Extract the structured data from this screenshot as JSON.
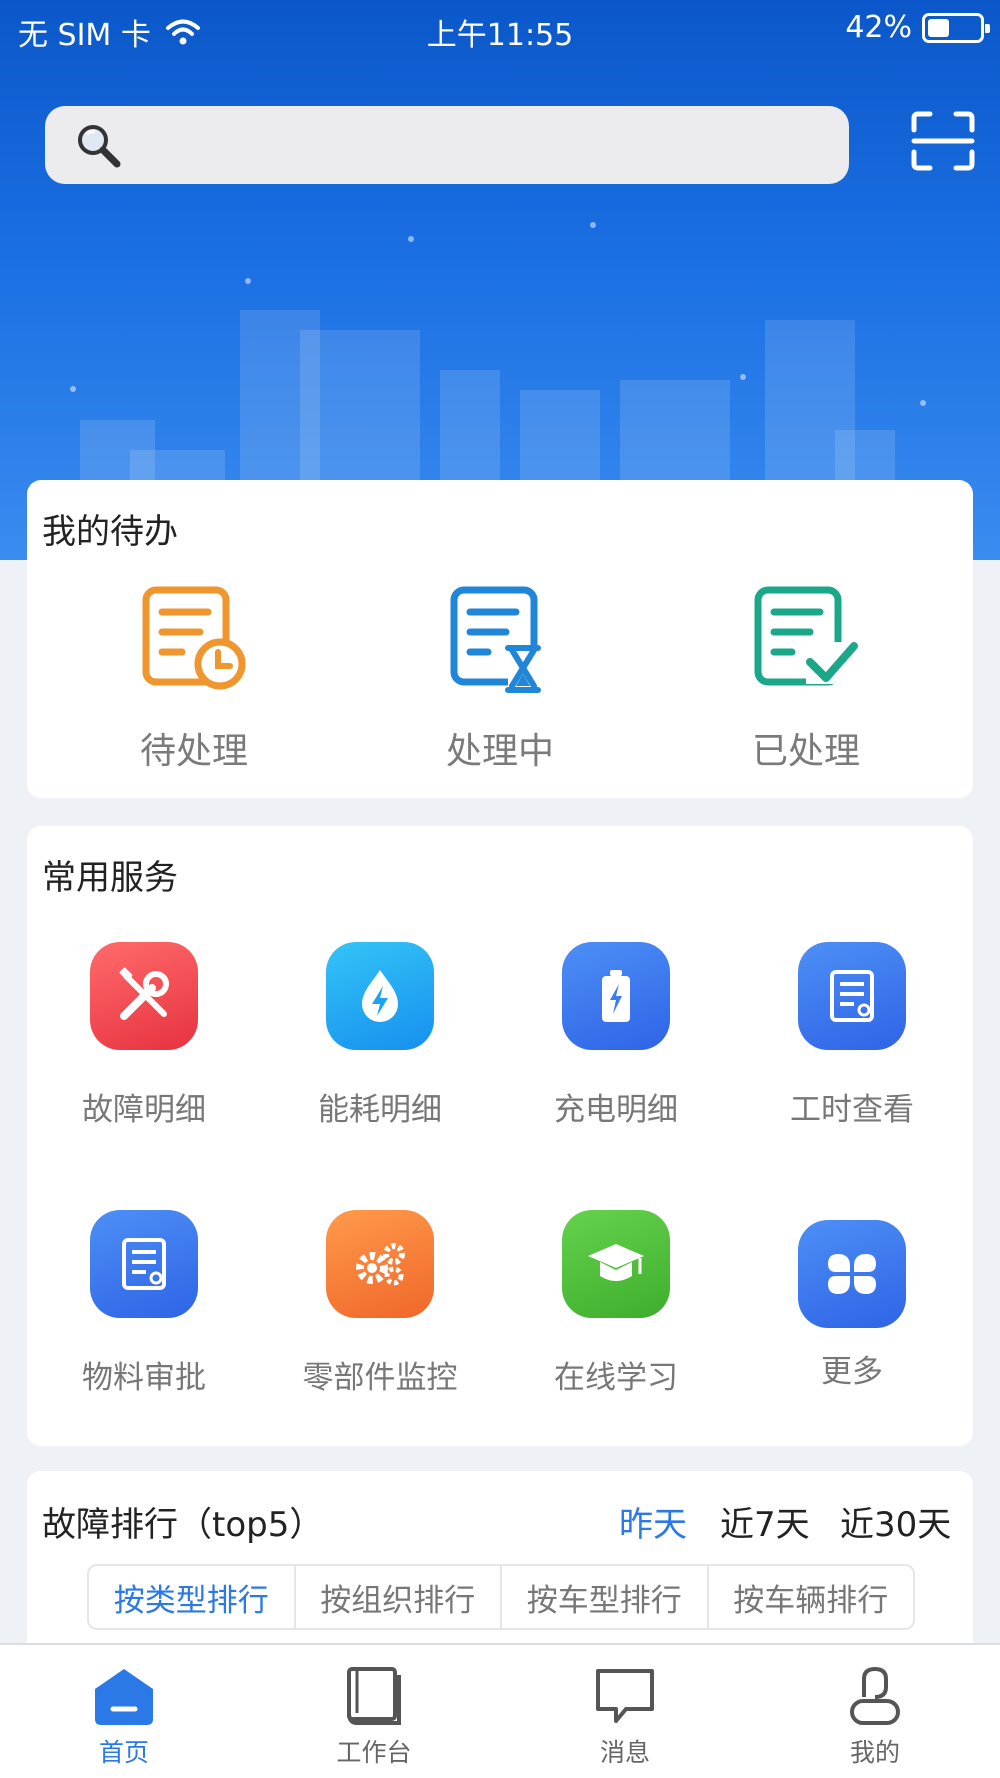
{
  "status_bar": {
    "carrier": "无 SIM 卡",
    "time": "上午11:55",
    "battery": "42%",
    "battery_level": 0.42
  },
  "search": {
    "placeholder": ""
  },
  "todo": {
    "title": "我的待办",
    "items": [
      {
        "label": "待处理",
        "icon": "pending-doc-clock-icon",
        "color": "#f0962e"
      },
      {
        "label": "处理中",
        "icon": "processing-doc-hourglass-icon",
        "color": "#1f86d8"
      },
      {
        "label": "已处理",
        "icon": "done-doc-check-icon",
        "color": "#1ba889"
      }
    ]
  },
  "services": {
    "title": "常用服务",
    "items": [
      {
        "label": "故障明细",
        "icon": "wrench-screwdriver-icon",
        "color": "#ef4b55"
      },
      {
        "label": "能耗明细",
        "icon": "energy-drop-icon",
        "color": "#1ea3f2"
      },
      {
        "label": "充电明细",
        "icon": "battery-charge-icon",
        "color": "#3b7cf0"
      },
      {
        "label": "工时查看",
        "icon": "doc-search-icon",
        "color": "#3b78ef"
      },
      {
        "label": "物料审批",
        "icon": "doc-search-icon",
        "color": "#3b78ef"
      },
      {
        "label": "零部件监控",
        "icon": "gears-icon",
        "color": "#f57a35"
      },
      {
        "label": "在线学习",
        "icon": "graduation-cap-icon",
        "color": "#4fc23c"
      },
      {
        "label": "更多",
        "icon": "more-grid-icon",
        "color": "#3b78ef"
      }
    ]
  },
  "ranking": {
    "title": "故障排行（top5）",
    "ranges": [
      "昨天",
      "近7天",
      "近30天"
    ],
    "active_range": "昨天",
    "tabs": [
      "按类型排行",
      "按组织排行",
      "按车型排行",
      "按车辆排行"
    ],
    "active_tab": "按类型排行"
  },
  "tab_bar": {
    "items": [
      {
        "label": "首页",
        "icon": "home-icon",
        "active": true
      },
      {
        "label": "工作台",
        "icon": "book-icon",
        "active": false
      },
      {
        "label": "消息",
        "icon": "message-icon",
        "active": false
      },
      {
        "label": "我的",
        "icon": "user-icon",
        "active": false
      }
    ]
  },
  "colors": {
    "accent": "#2b79e6",
    "header": "#0b57c9"
  }
}
